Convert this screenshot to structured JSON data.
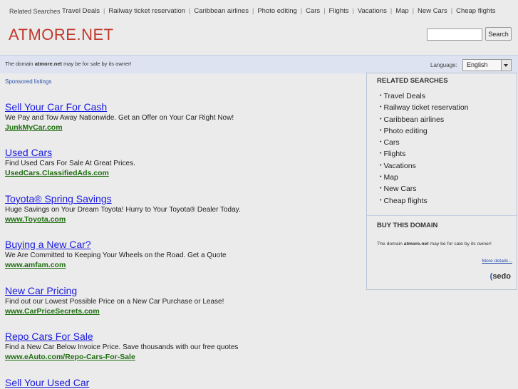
{
  "top": {
    "label": "Related Searches",
    "links": [
      "Travel Deals",
      "Railway ticket reservation",
      "Caribbean airlines",
      "Photo editing",
      "Cars",
      "Flights",
      "Vacations",
      "Map",
      "New Cars",
      "Cheap flights"
    ]
  },
  "header": {
    "logo": "ATMORE.NET",
    "search_placeholder": "",
    "search_button": "Search"
  },
  "domainbar": {
    "msg_prefix": "The domain ",
    "domain": "atmore.net",
    "msg_suffix": " may be for sale by its owner!",
    "language_label": "Language:",
    "language_value": "English"
  },
  "ads": {
    "sponsored_label": "Sponsored listings",
    "items": [
      {
        "title": "Sell Your Car For Cash",
        "desc": "We Pay and Tow Away Nationwide. Get an Offer on Your Car Right Now!",
        "url": "JunkMyCar.com"
      },
      {
        "title": "Used Cars",
        "desc": "Find Used Cars For Sale At Great Prices.",
        "url": "UsedCars.ClassifiedAds.com"
      },
      {
        "title": "Toyota® Spring Savings",
        "desc": "Huge Savings on Your Dream Toyota! Hurry to Your Toyota® Dealer Today.",
        "url": "www.Toyota.com"
      },
      {
        "title": "Buying a New Car?",
        "desc": "We Are Committed to Keeping Your Wheels on the Road. Get a Quote",
        "url": "www.amfam.com"
      },
      {
        "title": "New Car Pricing",
        "desc": "Find out our Lowest Possible Price on a New Car Purchase or Lease!",
        "url": "www.CarPriceSecrets.com"
      },
      {
        "title": "Repo Cars For Sale",
        "desc": "Find a New Car Below Invoice Price. Save thousands with our free quotes",
        "url": "www.eAuto.com/Repo-Cars-For-Sale"
      },
      {
        "title": "Sell Your Used Car",
        "desc": "",
        "url": ""
      }
    ]
  },
  "sidebar": {
    "related_title": "RELATED SEARCHES",
    "related": [
      "Travel Deals",
      "Railway ticket reservation",
      "Caribbean airlines",
      "Photo editing",
      "Cars",
      "Flights",
      "Vacations",
      "Map",
      "New Cars",
      "Cheap flights"
    ],
    "buy_title": "BUY THIS DOMAIN",
    "buy_prefix": "The domain ",
    "buy_domain": "atmore.net",
    "buy_suffix": " may be for sale by its owner!",
    "more_details": "More details...",
    "sedo": "sedo"
  }
}
